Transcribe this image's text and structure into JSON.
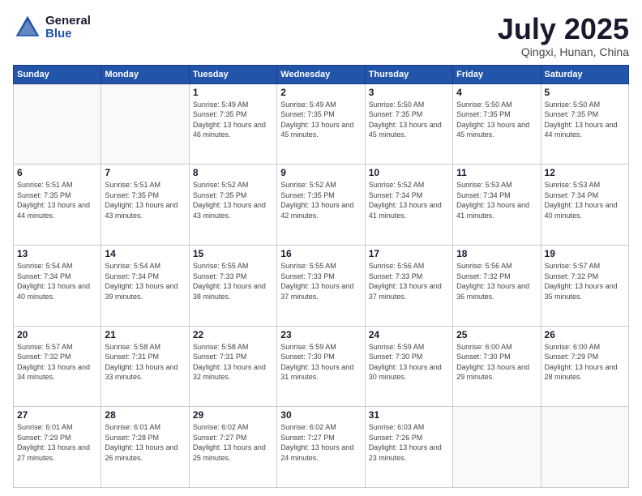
{
  "logo": {
    "general": "General",
    "blue": "Blue"
  },
  "title": "July 2025",
  "subtitle": "Qingxi, Hunan, China",
  "weekdays": [
    "Sunday",
    "Monday",
    "Tuesday",
    "Wednesday",
    "Thursday",
    "Friday",
    "Saturday"
  ],
  "weeks": [
    [
      {
        "day": "",
        "info": ""
      },
      {
        "day": "",
        "info": ""
      },
      {
        "day": "1",
        "info": "Sunrise: 5:49 AM\nSunset: 7:35 PM\nDaylight: 13 hours and 46 minutes."
      },
      {
        "day": "2",
        "info": "Sunrise: 5:49 AM\nSunset: 7:35 PM\nDaylight: 13 hours and 45 minutes."
      },
      {
        "day": "3",
        "info": "Sunrise: 5:50 AM\nSunset: 7:35 PM\nDaylight: 13 hours and 45 minutes."
      },
      {
        "day": "4",
        "info": "Sunrise: 5:50 AM\nSunset: 7:35 PM\nDaylight: 13 hours and 45 minutes."
      },
      {
        "day": "5",
        "info": "Sunrise: 5:50 AM\nSunset: 7:35 PM\nDaylight: 13 hours and 44 minutes."
      }
    ],
    [
      {
        "day": "6",
        "info": "Sunrise: 5:51 AM\nSunset: 7:35 PM\nDaylight: 13 hours and 44 minutes."
      },
      {
        "day": "7",
        "info": "Sunrise: 5:51 AM\nSunset: 7:35 PM\nDaylight: 13 hours and 43 minutes."
      },
      {
        "day": "8",
        "info": "Sunrise: 5:52 AM\nSunset: 7:35 PM\nDaylight: 13 hours and 43 minutes."
      },
      {
        "day": "9",
        "info": "Sunrise: 5:52 AM\nSunset: 7:35 PM\nDaylight: 13 hours and 42 minutes."
      },
      {
        "day": "10",
        "info": "Sunrise: 5:52 AM\nSunset: 7:34 PM\nDaylight: 13 hours and 41 minutes."
      },
      {
        "day": "11",
        "info": "Sunrise: 5:53 AM\nSunset: 7:34 PM\nDaylight: 13 hours and 41 minutes."
      },
      {
        "day": "12",
        "info": "Sunrise: 5:53 AM\nSunset: 7:34 PM\nDaylight: 13 hours and 40 minutes."
      }
    ],
    [
      {
        "day": "13",
        "info": "Sunrise: 5:54 AM\nSunset: 7:34 PM\nDaylight: 13 hours and 40 minutes."
      },
      {
        "day": "14",
        "info": "Sunrise: 5:54 AM\nSunset: 7:34 PM\nDaylight: 13 hours and 39 minutes."
      },
      {
        "day": "15",
        "info": "Sunrise: 5:55 AM\nSunset: 7:33 PM\nDaylight: 13 hours and 38 minutes."
      },
      {
        "day": "16",
        "info": "Sunrise: 5:55 AM\nSunset: 7:33 PM\nDaylight: 13 hours and 37 minutes."
      },
      {
        "day": "17",
        "info": "Sunrise: 5:56 AM\nSunset: 7:33 PM\nDaylight: 13 hours and 37 minutes."
      },
      {
        "day": "18",
        "info": "Sunrise: 5:56 AM\nSunset: 7:32 PM\nDaylight: 13 hours and 36 minutes."
      },
      {
        "day": "19",
        "info": "Sunrise: 5:57 AM\nSunset: 7:32 PM\nDaylight: 13 hours and 35 minutes."
      }
    ],
    [
      {
        "day": "20",
        "info": "Sunrise: 5:57 AM\nSunset: 7:32 PM\nDaylight: 13 hours and 34 minutes."
      },
      {
        "day": "21",
        "info": "Sunrise: 5:58 AM\nSunset: 7:31 PM\nDaylight: 13 hours and 33 minutes."
      },
      {
        "day": "22",
        "info": "Sunrise: 5:58 AM\nSunset: 7:31 PM\nDaylight: 13 hours and 32 minutes."
      },
      {
        "day": "23",
        "info": "Sunrise: 5:59 AM\nSunset: 7:30 PM\nDaylight: 13 hours and 31 minutes."
      },
      {
        "day": "24",
        "info": "Sunrise: 5:59 AM\nSunset: 7:30 PM\nDaylight: 13 hours and 30 minutes."
      },
      {
        "day": "25",
        "info": "Sunrise: 6:00 AM\nSunset: 7:30 PM\nDaylight: 13 hours and 29 minutes."
      },
      {
        "day": "26",
        "info": "Sunrise: 6:00 AM\nSunset: 7:29 PM\nDaylight: 13 hours and 28 minutes."
      }
    ],
    [
      {
        "day": "27",
        "info": "Sunrise: 6:01 AM\nSunset: 7:29 PM\nDaylight: 13 hours and 27 minutes."
      },
      {
        "day": "28",
        "info": "Sunrise: 6:01 AM\nSunset: 7:28 PM\nDaylight: 13 hours and 26 minutes."
      },
      {
        "day": "29",
        "info": "Sunrise: 6:02 AM\nSunset: 7:27 PM\nDaylight: 13 hours and 25 minutes."
      },
      {
        "day": "30",
        "info": "Sunrise: 6:02 AM\nSunset: 7:27 PM\nDaylight: 13 hours and 24 minutes."
      },
      {
        "day": "31",
        "info": "Sunrise: 6:03 AM\nSunset: 7:26 PM\nDaylight: 13 hours and 23 minutes."
      },
      {
        "day": "",
        "info": ""
      },
      {
        "day": "",
        "info": ""
      }
    ]
  ]
}
